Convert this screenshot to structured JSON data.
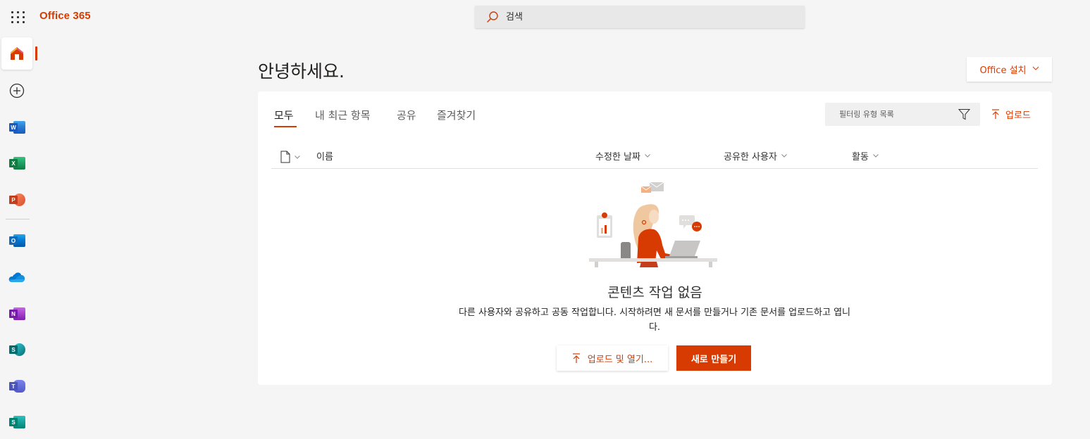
{
  "header": {
    "brand": "Office 365",
    "search": {
      "placeholder": "검색"
    }
  },
  "rail": {
    "items": [
      {
        "name": "home",
        "label": "홈"
      },
      {
        "name": "create",
        "label": "만들기"
      },
      {
        "name": "word",
        "letter": "W",
        "color": "#185abd"
      },
      {
        "name": "excel",
        "letter": "X",
        "color": "#107c41"
      },
      {
        "name": "powerpoint",
        "letter": "P",
        "color": "#c43e1c"
      },
      {
        "name": "outlook",
        "letter": "O",
        "color": "#0f6cbd"
      },
      {
        "name": "onedrive"
      },
      {
        "name": "onenote",
        "letter": "N",
        "color": "#7719aa"
      },
      {
        "name": "sharepoint",
        "letter": "S",
        "color": "#036c70"
      },
      {
        "name": "teams",
        "letter": "T",
        "color": "#4b53bc"
      },
      {
        "name": "sway",
        "letter": "S",
        "color": "#008272"
      }
    ]
  },
  "main": {
    "greeting": "안녕하세요.",
    "install_button": "Office 설치",
    "tabs": [
      {
        "label": "모두",
        "selected": true
      },
      {
        "label": "내 최근 항목"
      },
      {
        "label": "공유"
      },
      {
        "label": "즐겨찾기"
      }
    ],
    "filter": {
      "placeholder": "필터링 유형 목록"
    },
    "upload_link": "업로드",
    "columns": {
      "name": "이름",
      "modified": "수정한 날짜",
      "shared_by": "공유한 사용자",
      "activity": "활동"
    },
    "empty": {
      "title": "콘텐츠 작업 없음",
      "description": "다른 사용자와 공유하고 공동 작업합니다. 시작하려면 새 문서를 만들거나 기존 문서를 업로드하고 엽니다.",
      "upload_open_button": "업로드 및 열기...",
      "create_new_button": "새로 만들기"
    }
  },
  "colors": {
    "accent": "#d83b01",
    "background": "#f5f5f5",
    "card": "#ffffff"
  }
}
